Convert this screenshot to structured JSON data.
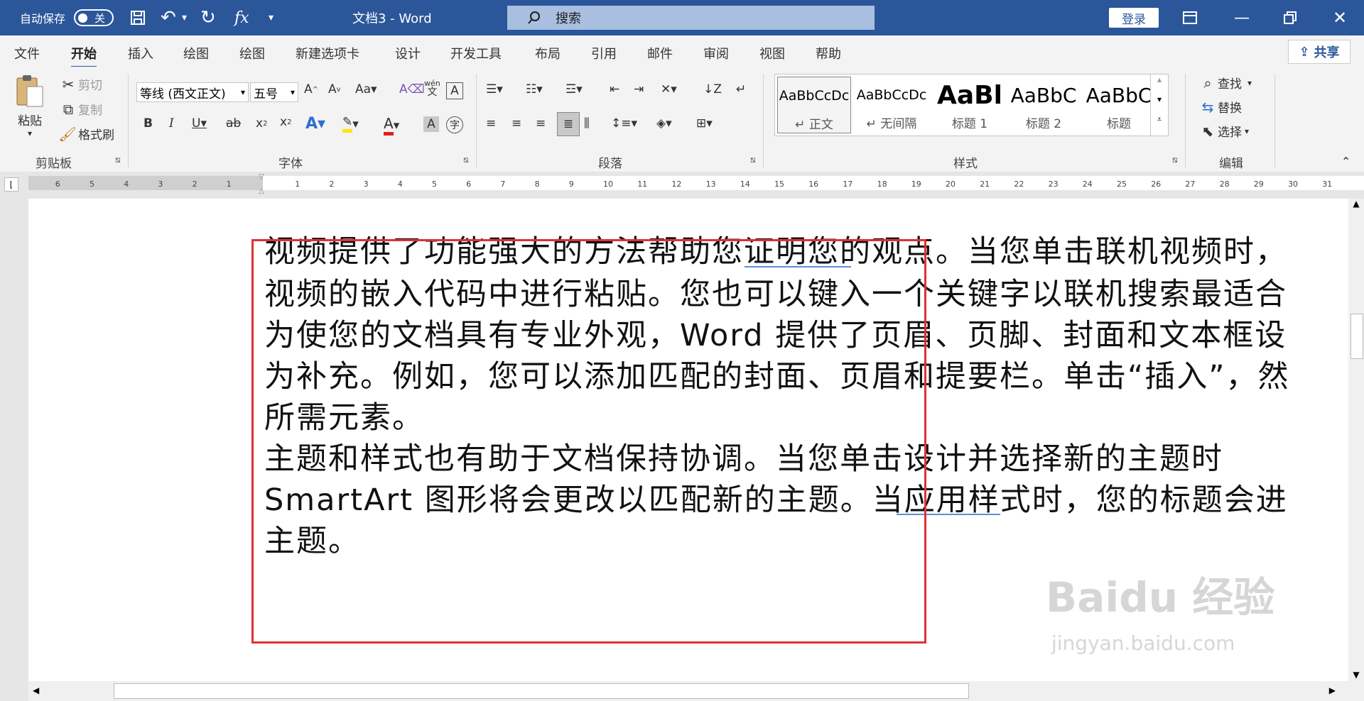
{
  "titlebar": {
    "autosave_label": "自动保存",
    "autosave_state": "关",
    "doc_title": "文档3  -  Word",
    "search_placeholder": "搜索",
    "login_label": "登录"
  },
  "menu": {
    "tabs": [
      "文件",
      "开始",
      "插入",
      "绘图",
      "绘图",
      "新建选项卡",
      "设计",
      "开发工具",
      "布局",
      "引用",
      "邮件",
      "审阅",
      "视图",
      "帮助"
    ],
    "active_tab": "开始",
    "share_label": "共享"
  },
  "ribbon": {
    "clipboard": {
      "paste": "粘贴",
      "cut": "剪切",
      "copy": "复制",
      "format_painter": "格式刷",
      "group": "剪贴板"
    },
    "font": {
      "font_name": "等线 (西文正文)",
      "font_size": "五号",
      "group": "字体"
    },
    "paragraph": {
      "group": "段落"
    },
    "styles": {
      "items": [
        {
          "sample": "AaBbCcDc",
          "name": "↵ 正文"
        },
        {
          "sample": "AaBbCcDc",
          "name": "↵ 无间隔"
        },
        {
          "sample": "AaBl",
          "name": "标题 1"
        },
        {
          "sample": "AaBbC",
          "name": "标题 2"
        },
        {
          "sample": "AaBbC",
          "name": "标题"
        }
      ],
      "group": "样式"
    },
    "editing": {
      "find": "查找",
      "replace": "替换",
      "select": "选择",
      "group": "编辑"
    }
  },
  "ruler": {
    "left_numbers": [
      "6",
      "5",
      "4",
      "3",
      "2",
      "1"
    ],
    "right_numbers": [
      "1",
      "2",
      "3",
      "4",
      "5",
      "6",
      "7",
      "8",
      "9",
      "10",
      "11",
      "12",
      "13",
      "14",
      "15",
      "16",
      "17",
      "18",
      "19",
      "20",
      "21",
      "22",
      "23",
      "24",
      "25",
      "26",
      "27",
      "28",
      "29",
      "30",
      "31",
      "32"
    ]
  },
  "document": {
    "lines": [
      "视频提供了功能强大的方法帮助您证明您的观点。当您单击联机视频时，",
      "视频的嵌入代码中进行粘贴。您也可以键入一个关键字以联机搜索最适合",
      "为使您的文档具有专业外观，Word 提供了页眉、页脚、封面和文本框设",
      "为补充。例如，您可以添加匹配的封面、页眉和提要栏。单击“插入”，然",
      "所需元素。",
      "主题和样式也有助于文档保持协调。当您单击设计并选择新的主题时",
      "SmartArt 图形将会更改以匹配新的主题。当应用样式时，您的标题会进",
      "主题。"
    ]
  },
  "watermark": {
    "brand": "Baidu 经验",
    "url": "jingyan.baidu.com"
  }
}
